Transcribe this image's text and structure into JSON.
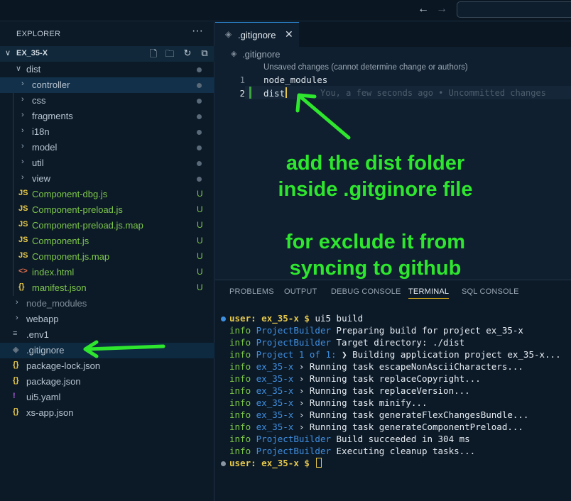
{
  "sidebar": {
    "title": "EXPLORER",
    "more_icon": "ellipsis-icon",
    "root_label": "EX_35-X",
    "toolbar_icons": [
      "new-file-icon",
      "new-folder-icon",
      "refresh-icon",
      "collapse-all-icon"
    ],
    "items": [
      {
        "label": "dist",
        "kind": "folder",
        "open": true,
        "indent": 1,
        "color": "#b8c4d0",
        "status": "dot"
      },
      {
        "label": "controller",
        "kind": "folder",
        "indent": 2,
        "color": "#b8c4d0",
        "status": "dot",
        "state": "active"
      },
      {
        "label": "css",
        "kind": "folder",
        "indent": 2,
        "color": "#b8c4d0",
        "status": "dot"
      },
      {
        "label": "fragments",
        "kind": "folder",
        "indent": 2,
        "color": "#b8c4d0",
        "status": "dot"
      },
      {
        "label": "i18n",
        "kind": "folder",
        "indent": 2,
        "color": "#b8c4d0",
        "status": "dot"
      },
      {
        "label": "model",
        "kind": "folder",
        "indent": 2,
        "color": "#b8c4d0",
        "status": "dot"
      },
      {
        "label": "util",
        "kind": "folder",
        "indent": 2,
        "color": "#b8c4d0",
        "status": "dot"
      },
      {
        "label": "view",
        "kind": "folder",
        "indent": 2,
        "color": "#b8c4d0",
        "status": "dot"
      },
      {
        "label": "Component-dbg.js",
        "kind": "file",
        "icon": "JS",
        "icon_color": "#e6c84a",
        "indent": 2,
        "color": "#7ec74a",
        "status": "U"
      },
      {
        "label": "Component-preload.js",
        "kind": "file",
        "icon": "JS",
        "icon_color": "#e6c84a",
        "indent": 2,
        "color": "#7ec74a",
        "status": "U"
      },
      {
        "label": "Component-preload.js.map",
        "kind": "file",
        "icon": "JS",
        "icon_color": "#e6c84a",
        "indent": 2,
        "color": "#7ec74a",
        "status": "U"
      },
      {
        "label": "Component.js",
        "kind": "file",
        "icon": "JS",
        "icon_color": "#e6c84a",
        "indent": 2,
        "color": "#7ec74a",
        "status": "U"
      },
      {
        "label": "Component.js.map",
        "kind": "file",
        "icon": "JS",
        "icon_color": "#e6c84a",
        "indent": 2,
        "color": "#7ec74a",
        "status": "U"
      },
      {
        "label": "index.html",
        "kind": "file",
        "icon": "<>",
        "icon_color": "#e06c4a",
        "indent": 2,
        "color": "#7ec74a",
        "status": "U"
      },
      {
        "label": "manifest.json",
        "kind": "file",
        "icon": "{}",
        "icon_color": "#e6c84a",
        "indent": 2,
        "color": "#7ec74a",
        "status": "U"
      },
      {
        "label": "node_modules",
        "kind": "folder",
        "indent": 1,
        "color": "#7f8c98"
      },
      {
        "label": "webapp",
        "kind": "folder",
        "indent": 1,
        "color": "#b8c4d0"
      },
      {
        "label": ".env1",
        "kind": "file",
        "icon": "≡",
        "icon_color": "#9aa6b2",
        "indent": 1,
        "color": "#b8c4d0"
      },
      {
        "label": ".gitignore",
        "kind": "file",
        "icon": "◈",
        "icon_color": "#6a7886",
        "indent": 1,
        "color": "#b8c4d0",
        "state": "selected"
      },
      {
        "label": "package-lock.json",
        "kind": "file",
        "icon": "{}",
        "icon_color": "#e6c84a",
        "indent": 1,
        "color": "#b8c4d0"
      },
      {
        "label": "package.json",
        "kind": "file",
        "icon": "{}",
        "icon_color": "#e6c84a",
        "indent": 1,
        "color": "#b8c4d0"
      },
      {
        "label": "ui5.yaml",
        "kind": "file",
        "icon": "!",
        "icon_color": "#b060e0",
        "indent": 1,
        "color": "#b8c4d0"
      },
      {
        "label": "xs-app.json",
        "kind": "file",
        "icon": "{}",
        "icon_color": "#e6c84a",
        "indent": 1,
        "color": "#b8c4d0"
      }
    ]
  },
  "editor": {
    "tab_label": ".gitignore",
    "breadcrumb": ".gitignore",
    "codelens": "Unsaved changes (cannot determine change or authors)",
    "lines": [
      {
        "num": "1",
        "text": "node_modules"
      },
      {
        "num": "2",
        "text": "dist"
      }
    ],
    "blame": "You, a few seconds ago • Uncommitted changes",
    "annotation_lines": [
      "add the dist folder",
      "inside .gitginore file",
      "",
      "for exclude it from",
      "syncing to github"
    ]
  },
  "panel": {
    "tabs": [
      "PROBLEMS",
      "OUTPUT",
      "DEBUG CONSOLE",
      "TERMINAL",
      "SQL CONSOLE"
    ],
    "active_tab": "TERMINAL",
    "prompt_user": "user:",
    "prompt_dir": "ex_35-x $",
    "command": "ui5 build",
    "log": [
      {
        "level": "info",
        "source": "ProjectBuilder",
        "message": "Preparing build for project ex_35-x"
      },
      {
        "level": "info",
        "source": "ProjectBuilder",
        "message": "  Target directory: ./dist"
      },
      {
        "level": "info",
        "source": "Project 1 of 1:",
        "message": "❯ Building application project ex_35-x..."
      },
      {
        "level": "info",
        "source": "ex_35-x",
        "message": "› Running task escapeNonAsciiCharacters..."
      },
      {
        "level": "info",
        "source": "ex_35-x",
        "message": "› Running task replaceCopyright..."
      },
      {
        "level": "info",
        "source": "ex_35-x",
        "message": "› Running task replaceVersion..."
      },
      {
        "level": "info",
        "source": "ex_35-x",
        "message": "› Running task minify..."
      },
      {
        "level": "info",
        "source": "ex_35-x",
        "message": "› Running task generateFlexChangesBundle..."
      },
      {
        "level": "info",
        "source": "ex_35-x",
        "message": "› Running task generateComponentPreload..."
      },
      {
        "level": "info",
        "source": "ProjectBuilder",
        "message": "Build succeeded in 304 ms"
      },
      {
        "level": "info",
        "source": "ProjectBuilder",
        "message": "Executing cleanup tasks..."
      }
    ]
  },
  "colors": {
    "accent_green": "#2ee62e",
    "git_untracked": "#7ec74a",
    "prompt_yellow": "#e6c84a",
    "info_blue": "#3f8fe0"
  }
}
